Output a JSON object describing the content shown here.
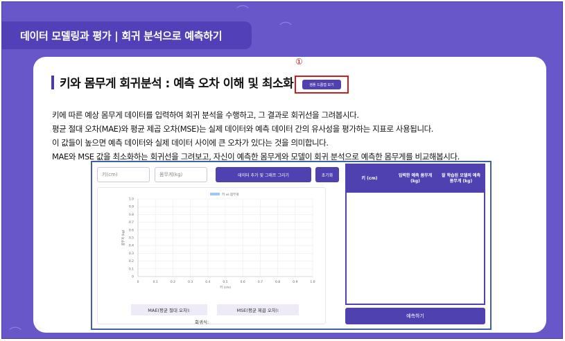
{
  "header": {
    "title": "데이터 모델링과 평가 | 회귀 분석으로 예측하기"
  },
  "section": {
    "title": "키와 몸무게 회귀분석 : 예측 오차 이해 및 최소화",
    "marker": "①",
    "sample_button": "샘플 드롭랩 보기"
  },
  "description": [
    "키에 따른 예상 몸무게 데이터를 입력하여 회귀 분석을 수행하고, 그 결과로 회귀선을 그려봅시다.",
    "평균 절대 오차(MAE)와 평균 제곱 오차(MSE)는 실제 데이터와 예측 데이터 간의 유사성을 평가하는 지표로 사용됩니다.",
    "이 값들이 높으면 예측 데이터와 실제 데이터 사이에 큰 오차가 있다는 것을 의미합니다.",
    "MAE와 MSE 값을 최소화하는 회귀선을 그려보고, 자신이 예측한 몸무게와 모델이 회귀 분석으로 예측한 몸무게를 비교해봅시다."
  ],
  "inputs": {
    "height_placeholder": "키(cm)",
    "weight_placeholder": "몸무게(kg)"
  },
  "buttons": {
    "add": "데이터 추가 및 그래프 그리기",
    "reset": "초기화",
    "predict": "예측하기"
  },
  "chart_data": {
    "type": "scatter",
    "legend": "키 vs 몸무게",
    "xlabel": "키 (cm)",
    "ylabel": "몸무게 (kg)",
    "xlim": [
      0,
      1.0
    ],
    "ylim": [
      0,
      1.0
    ],
    "xticks": [
      "0",
      "0.1",
      "0.2",
      "0.3",
      "0.4",
      "0.5",
      "0.6",
      "0.7",
      "0.8",
      "0.9",
      "1.0"
    ],
    "yticks": [
      "0",
      "0.1",
      "0.2",
      "0.3",
      "0.4",
      "0.5",
      "0.6",
      "0.7",
      "0.8",
      "0.9",
      "1.0"
    ],
    "values": [],
    "grid": true,
    "legend_position": "top-center",
    "legend_color": "#9ec9f0"
  },
  "metrics": {
    "mae": "MAE(평균 절대 오차):",
    "mse": "MSE(평균 제곱 오차):",
    "formula": "회귀식:"
  },
  "table": {
    "headers": [
      "키 (cm)",
      "입력한 예측 몸무게 (kg)",
      "잘 학습된 모델의 예측 몸무게 (kg)"
    ],
    "rows": []
  },
  "colors": {
    "background": "#6757c9",
    "header_tab": "#5140b8",
    "accent": "#5041b0",
    "highlight": "#d11a1a",
    "sim_border": "#3c5fa6"
  }
}
